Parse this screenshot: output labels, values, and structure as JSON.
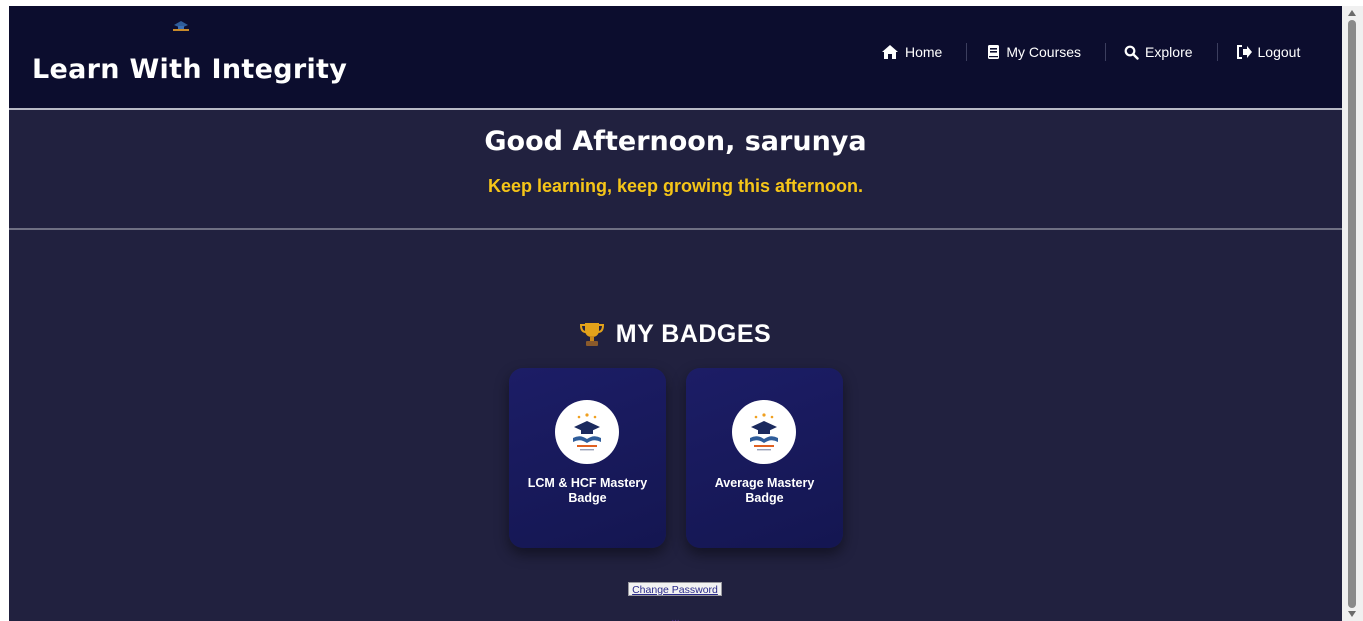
{
  "brand": {
    "title": "Learn With Integrity",
    "logo_icon": "graduation-cap-logo-icon"
  },
  "nav": [
    {
      "label": "Home",
      "icon": "home-icon"
    },
    {
      "label": "My Courses",
      "icon": "book-icon"
    },
    {
      "label": "Explore",
      "icon": "search-icon"
    },
    {
      "label": "Logout",
      "icon": "logout-icon"
    }
  ],
  "greeting": {
    "title": "Good Afternoon, sarunya",
    "subtitle": "Keep learning, keep growing this afternoon."
  },
  "badges": {
    "heading": "MY BADGES",
    "heading_icon": "trophy-icon",
    "items": [
      {
        "name": "LCM & HCF Mastery Badge",
        "icon": "badge-emblem-icon"
      },
      {
        "name": "Average Mastery Badge",
        "icon": "badge-emblem-icon"
      }
    ]
  },
  "actions": {
    "change_password_label": "Change Password"
  },
  "footer": {
    "text": "..."
  },
  "colors": {
    "navbar_bg": "#0c0d2e",
    "page_bg": "#21213f",
    "accent_yellow": "#f5c518",
    "badge_card_bg": "#1c1d66"
  }
}
